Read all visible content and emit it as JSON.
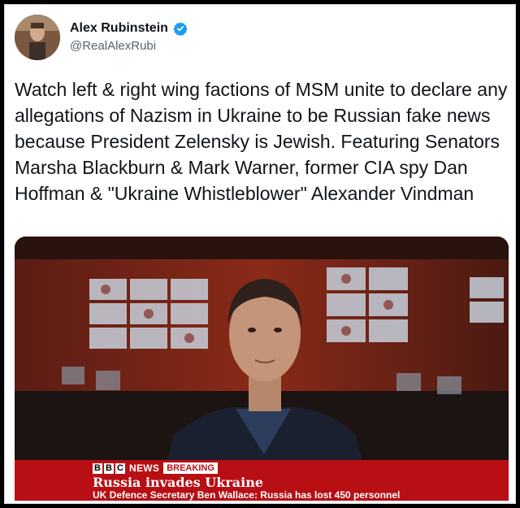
{
  "author": {
    "display_name": "Alex Rubinstein",
    "handle": "@RealAlexRubi",
    "verified": true,
    "verified_color": "#1d9bf0"
  },
  "tweet": {
    "text": "Watch left & right wing factions of MSM unite to declare any allegations of Nazism in Ukraine to be Russian fake news because President Zelensky is Jewish. Featuring Senators Marsha Blackburn & Mark Warner, former CIA spy Dan Hoffman & \"Ukraine Whistleblower\" Alexander Vindman"
  },
  "media": {
    "type": "video-still",
    "channel_boxes": [
      "B",
      "B",
      "C"
    ],
    "channel_label": "NEWS",
    "breaking_label": "BREAKING",
    "headline": "Russia invades Ukraine",
    "ticker": "UK Defence Secretary Ben Wallace: Russia has lost 450 personnel",
    "banner_color": "#b80f14"
  }
}
